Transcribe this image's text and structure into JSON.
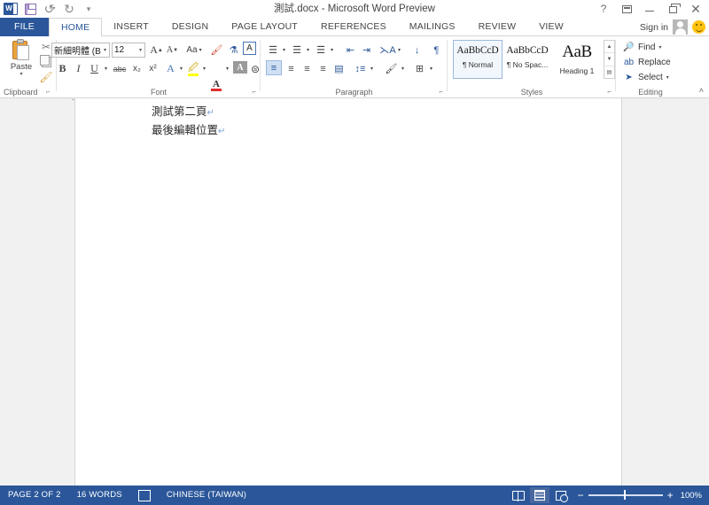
{
  "window": {
    "title": "測試.docx - Microsoft Word Preview",
    "quick_access": [
      {
        "name": "word-logo-icon",
        "label": "W"
      },
      {
        "name": "save-icon",
        "label": "Save"
      },
      {
        "name": "undo-icon",
        "label": "↺"
      },
      {
        "name": "redo-icon",
        "label": "↻"
      },
      {
        "name": "customize-quick-access-icon",
        "label": "▾"
      }
    ],
    "controls": {
      "help": "?",
      "ribbon_display_options": "Ribbon Display Options",
      "minimize": "Minimize",
      "restore": "Restore Down",
      "close": "✕"
    }
  },
  "tabs": [
    {
      "label": "FILE",
      "active": false,
      "file": true
    },
    {
      "label": "HOME",
      "active": true
    },
    {
      "label": "INSERT",
      "active": false
    },
    {
      "label": "DESIGN",
      "active": false
    },
    {
      "label": "PAGE LAYOUT",
      "active": false
    },
    {
      "label": "REFERENCES",
      "active": false
    },
    {
      "label": "MAILINGS",
      "active": false
    },
    {
      "label": "REVIEW",
      "active": false
    },
    {
      "label": "VIEW",
      "active": false
    }
  ],
  "account": {
    "sign_in": "Sign in",
    "avatar": "account-avatar",
    "feedback": "smiley-face-icon"
  },
  "ribbon": {
    "groups": [
      {
        "name": "clipboard",
        "label": "Clipboard"
      },
      {
        "name": "font",
        "label": "Font"
      },
      {
        "name": "paragraph",
        "label": "Paragraph"
      },
      {
        "name": "styles",
        "label": "Styles"
      },
      {
        "name": "editing",
        "label": "Editing"
      }
    ],
    "clipboard": {
      "paste_label": "Paste",
      "paste_caret": "▾",
      "cut": "✂",
      "copy": "Copy",
      "format_painter": "Format Painter"
    },
    "font": {
      "font_name_value": "新細明體 (Bo",
      "font_name_placeholder": "Font",
      "font_size_value": "12",
      "font_size_placeholder": "Size",
      "grow_font": "A",
      "shrink_font": "A",
      "change_case": "Aa",
      "clear_formatting": "Clear All Formatting",
      "phonetic_guide": "Phonetic Guide",
      "character_border": "A",
      "bold": "B",
      "italic": "I",
      "underline": "U",
      "strikethrough": "abc",
      "subscript": "x₂",
      "superscript": "x²",
      "text_effects": "A",
      "highlight_color": "Text Highlight Color",
      "font_color": "A",
      "character_shading": "A",
      "enclose_characters": "Enclose Characters",
      "dropdown_caret": "▾"
    },
    "paragraph": {
      "bullets": "Bullets",
      "numbering": "Numbering",
      "multilevel_list": "Multilevel List",
      "decrease_indent": "Decrease Indent",
      "increase_indent": "Increase Indent",
      "asian_layout": "Asian Layout",
      "sort": "Sort",
      "show_marks": "Show/Hide ¶",
      "align_left": "Align Left",
      "align_center": "Center",
      "align_right": "Align Right",
      "justify": "Justify",
      "distributed": "Distributed",
      "line_spacing": "Line and Paragraph Spacing",
      "shading": "Shading",
      "borders": "Borders",
      "dropdown_caret": "▾"
    },
    "styles": {
      "gallery": [
        {
          "preview": "AaBbCcD",
          "name": "¶ Normal",
          "selected": true,
          "heading": false
        },
        {
          "preview": "AaBbCcD",
          "name": "¶ No Spac...",
          "selected": false,
          "heading": false
        },
        {
          "preview": "AaB",
          "name": "Heading 1",
          "selected": false,
          "heading": true
        }
      ],
      "scroll_up": "▲",
      "scroll_down": "▼",
      "more": "▤"
    },
    "editing": {
      "find": "Find",
      "find_caret": "▾",
      "replace": "Replace",
      "select": "Select",
      "select_caret": "▾"
    },
    "collapse_ribbon": "˄",
    "dialog_launcher": "⌐"
  },
  "document": {
    "lines": [
      {
        "text": "測試第二頁",
        "mark": "↵"
      },
      {
        "text": "最後編輯位置",
        "mark": "↵"
      }
    ]
  },
  "status_bar": {
    "page": "PAGE 2 OF 2",
    "words": "16 WORDS",
    "proofing_icon": "proofing-errors-icon",
    "language": "CHINESE (TAIWAN)",
    "views": [
      {
        "name": "read-mode",
        "selected": false
      },
      {
        "name": "print-layout",
        "selected": true
      },
      {
        "name": "web-layout",
        "selected": false
      }
    ],
    "zoom_out": "−",
    "zoom_in": "+",
    "zoom_level": "100%"
  },
  "colors": {
    "accent": "#2b579a",
    "tab_active_text": "#2b579a",
    "status_bar": "#2b579a",
    "workspace": "#f1f1f1",
    "page": "#ffffff"
  }
}
